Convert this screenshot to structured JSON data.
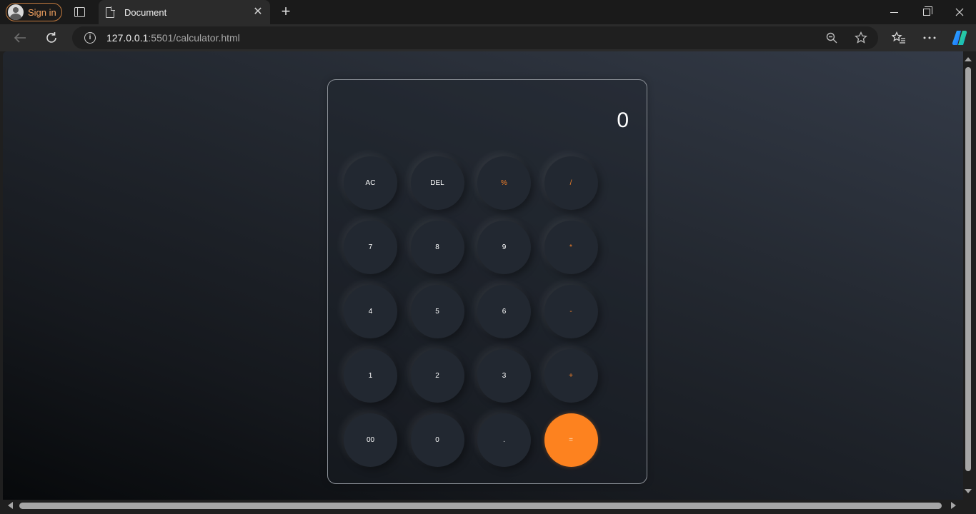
{
  "browser": {
    "profile_label": "Sign in",
    "tab_title": "Document",
    "tab_close": "✕",
    "new_tab": "+",
    "url_host": "127.0.0.1",
    "url_rest": ":5501/calculator.html",
    "info": "i"
  },
  "calculator": {
    "display": "0",
    "keys": [
      {
        "label": "AC",
        "type": "func"
      },
      {
        "label": "DEL",
        "type": "func"
      },
      {
        "label": "%",
        "type": "op"
      },
      {
        "label": "/",
        "type": "op"
      },
      {
        "label": "7",
        "type": "num"
      },
      {
        "label": "8",
        "type": "num"
      },
      {
        "label": "9",
        "type": "num"
      },
      {
        "label": "*",
        "type": "op"
      },
      {
        "label": "4",
        "type": "num"
      },
      {
        "label": "5",
        "type": "num"
      },
      {
        "label": "6",
        "type": "num"
      },
      {
        "label": "-",
        "type": "op"
      },
      {
        "label": "1",
        "type": "num"
      },
      {
        "label": "2",
        "type": "num"
      },
      {
        "label": "3",
        "type": "num"
      },
      {
        "label": "+",
        "type": "op"
      },
      {
        "label": "00",
        "type": "num"
      },
      {
        "label": "0",
        "type": "num"
      },
      {
        "label": ".",
        "type": "num"
      },
      {
        "label": "=",
        "type": "equals"
      }
    ]
  },
  "colors": {
    "accent_orange": "#fd821f",
    "operator_text": "#f5822a",
    "key_background": "#222831"
  }
}
